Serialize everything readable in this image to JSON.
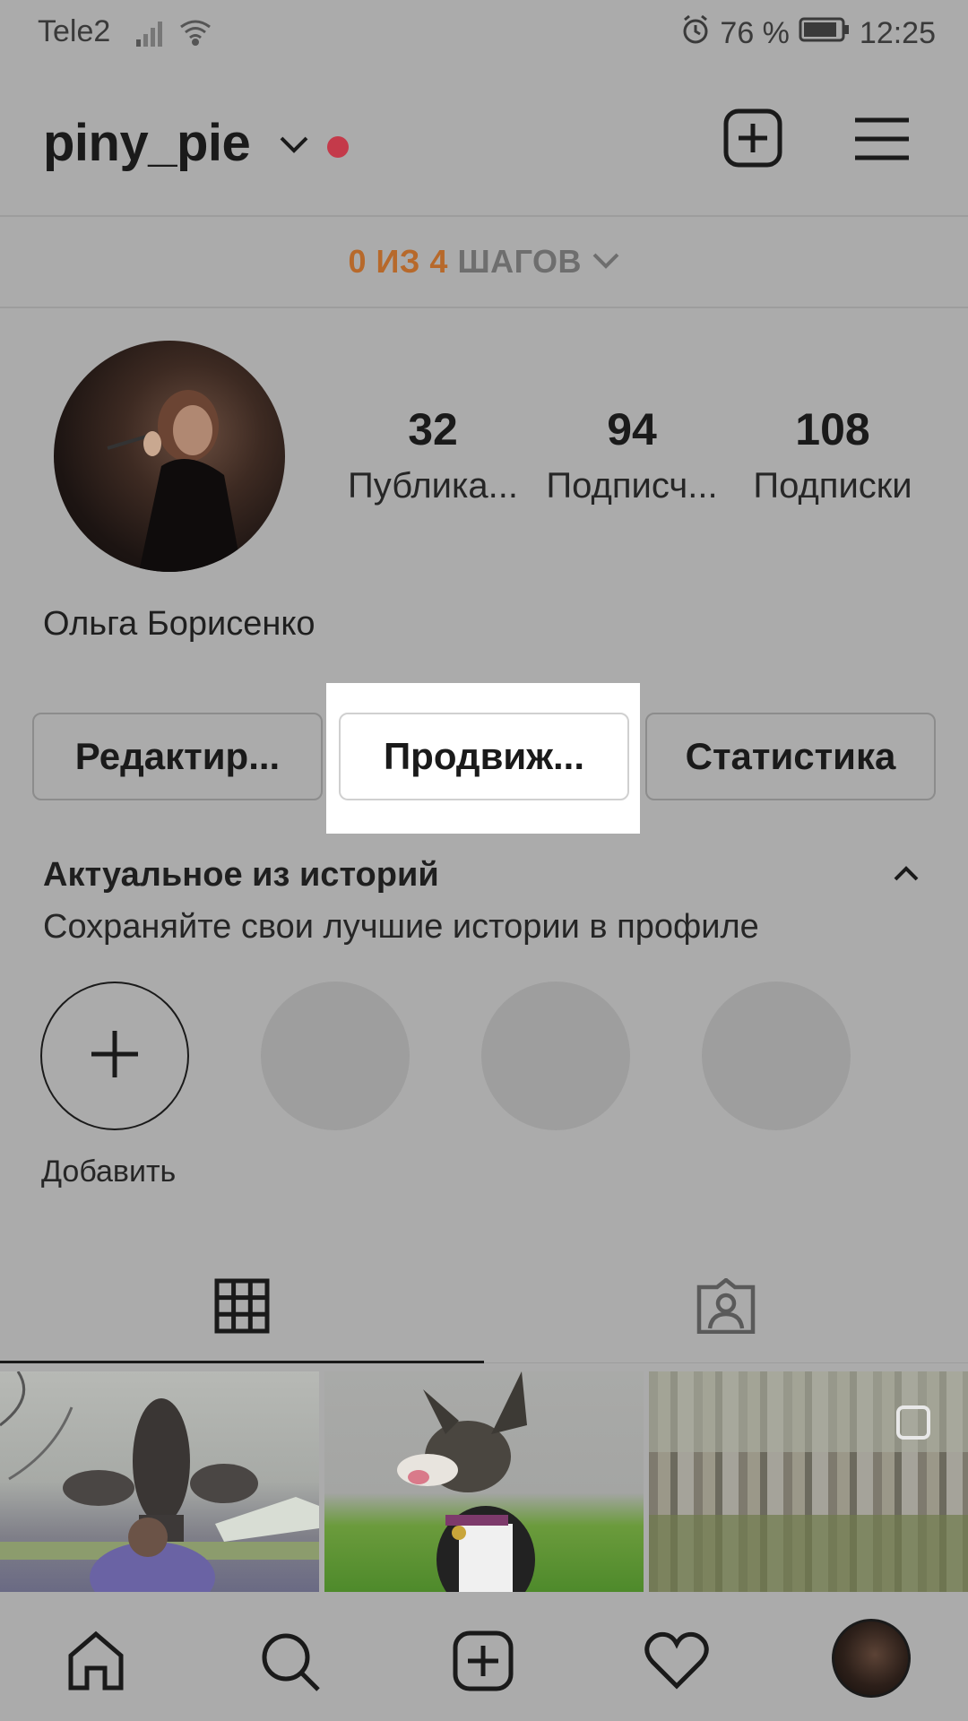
{
  "status_bar": {
    "carrier": "Tele2",
    "battery": "76 %",
    "time": "12:25"
  },
  "header": {
    "username": "piny_pie",
    "notification_color": "#c43a4a"
  },
  "steps": {
    "progress": "0 ИЗ 4",
    "label": "ШАГОВ",
    "accent_color": "#b7692b"
  },
  "profile": {
    "stats": [
      {
        "value": "32",
        "label": "Публика..."
      },
      {
        "value": "94",
        "label": "Подписч..."
      },
      {
        "value": "108",
        "label": "Подписки"
      }
    ],
    "full_name": "Ольга Борисенко"
  },
  "buttons": {
    "edit": "Редактир...",
    "promote": "Продвиж...",
    "insights": "Статистика"
  },
  "highlights": {
    "title": "Актуальное из историй",
    "subtitle": "Сохраняйте свои лучшие истории в профиле",
    "add_label": "Добавить"
  },
  "icons": {
    "header": [
      "add-post-icon",
      "menu-icon"
    ],
    "tabs": [
      "grid-icon",
      "tagged-icon"
    ],
    "bottom_nav": [
      "home-icon",
      "search-icon",
      "add-icon",
      "heart-icon",
      "profile-avatar"
    ]
  }
}
